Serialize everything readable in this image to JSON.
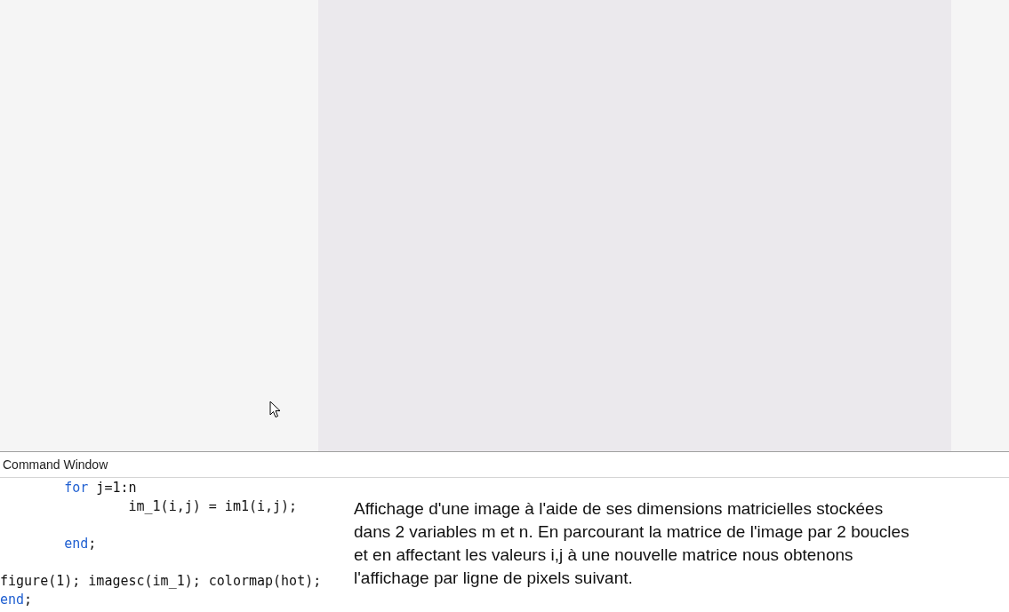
{
  "command_window": {
    "title": "Command Window",
    "code_lines": [
      {
        "kind": "code",
        "segments": [
          {
            "kind": "keyword",
            "text": "        for"
          },
          {
            "kind": "plain",
            "text": " j=1:n"
          }
        ]
      },
      {
        "kind": "code",
        "segments": [
          {
            "kind": "plain",
            "text": "                im_1(i,j) = im1(i,j);"
          }
        ]
      },
      {
        "kind": "blank"
      },
      {
        "kind": "code",
        "segments": [
          {
            "kind": "keyword",
            "text": "        end"
          },
          {
            "kind": "plain",
            "text": ";"
          }
        ]
      },
      {
        "kind": "blank"
      },
      {
        "kind": "code",
        "segments": [
          {
            "kind": "plain",
            "text": "figure(1); imagesc(im_1); colormap(hot);"
          }
        ]
      },
      {
        "kind": "code",
        "segments": [
          {
            "kind": "keyword",
            "text": "end"
          },
          {
            "kind": "plain",
            "text": ";"
          }
        ]
      }
    ],
    "description": "Affichage d'une image à l'aide de ses dimensions matricielles stockées dans 2 variables m et n. En parcourant la matrice de l'image par 2 boucles et en affectant les valeurs i,j à une nouvelle matrice nous obtenons l'affichage par ligne de pixels suivant."
  }
}
